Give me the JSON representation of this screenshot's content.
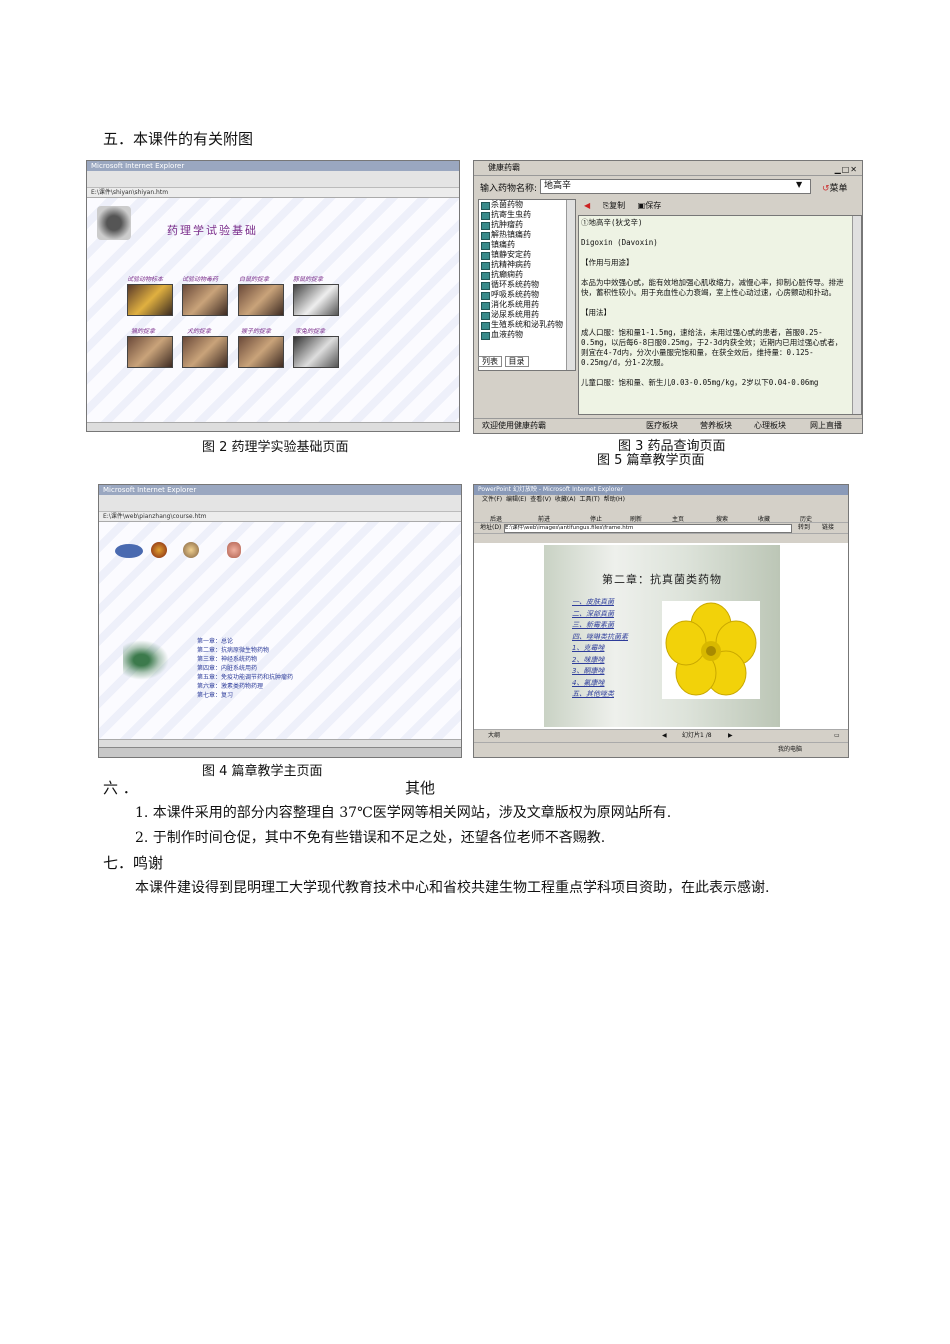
{
  "section5": {
    "heading": "五．本课件的有关附图"
  },
  "fig2": {
    "caption": "图 2 药理学实验基础页面",
    "banner": "药理学试验基础",
    "thumbs_row1": [
      "试验动物标本",
      "试验动物毒药",
      "白鼠的捉拿",
      "豚鼠的捉拿"
    ],
    "thumbs_row2": [
      "猫的捉拿",
      "犬的捉拿",
      "猴子的捉拿",
      "家兔的捉拿"
    ]
  },
  "fig3": {
    "caption": "图 3 药品查询页面",
    "window_title": "健康药霸",
    "search_label": "输入药物名称:",
    "search_value": "地高辛",
    "menu_label": "菜单",
    "copy_label": "复制",
    "save_label": "保存",
    "tree": [
      "杀菌药物",
      "抗寄生虫药",
      "抗肿瘤药",
      "解热镇痛药",
      "镇痛药",
      "镇静安定药",
      "抗精神病药",
      "抗癫痫药",
      "循环系统药物",
      "呼吸系统药物",
      "消化系统用药",
      "泌尿系统用药",
      "生殖系统和泌乳药物",
      "血液药物"
    ],
    "tab_list": "列表",
    "tab_dir": "目录",
    "content": [
      "①地高辛(狄戈辛)",
      "Digoxin (Davoxin)",
      "【作用与用途】",
      "本品为中效强心甙，能有效地加强心肌收缩力，减慢心率，抑制心脏传导。排泄快，蓄积性较小。用于充血性心力衰竭，室上性心动过速，心房颤动和扑动。",
      "【用法】",
      "成人口服：饱和量1-1.5mg，速给法，未用过强心甙的患者，首服0.25-0.5mg，以后每6-8日服0.25mg，于2-3d内获全效；近期内已用过强心甙者，则宜在4-7d内，分次小量服完饱和量，在获全效后，维持量：0.125-0.25mg/d，分1-2次服。",
      "儿童口服：饱和量、新生儿0.03-0.05mg/kg，2岁以下0.04-0.06mg"
    ],
    "status": "欢迎使用健康药霸",
    "status_btns": [
      "医疗板块",
      "营养板块",
      "心理板块",
      "网上直播"
    ]
  },
  "fig5": {
    "caption": "图 5 篇章教学页面"
  },
  "fig4": {
    "caption": "图 4 篇章教学主页面",
    "chapters": [
      "第一章：总论",
      "第二章：抗病原微生物药物",
      "第三章：神经系统药物",
      "第四章：内脏系统用药",
      "第五章：免疫功能调节药和抗肿瘤药",
      "第六章：激素类药物药理",
      "第七章：复习"
    ]
  },
  "fig5_shot": {
    "window_title": "PowerPoint 幻灯放映 - Microsoft Internet Explorer",
    "menu": [
      "文件(F)",
      "编辑(E)",
      "查看(V)",
      "收藏(A)",
      "工具(T)",
      "帮助(H)"
    ],
    "toolbar": [
      "后退",
      "前进",
      "停止",
      "刷新",
      "主页",
      "搜索",
      "收藏",
      "历史"
    ],
    "address": "E:\\课件\\web\\images\\antifungus.files\\frame.htm",
    "go": "转到",
    "links": "链接",
    "slide_title": "第二章：抗真菌类药物",
    "items": [
      "一、皮肤真菌",
      "二、深部真菌",
      "三、新霉素菌",
      "四、唑啉类抗菌素",
      "1、克霉唑",
      "2、咪康唑",
      "3、酮康唑",
      "4、氟康唑",
      "五、其他唑类"
    ],
    "outline": "大纲",
    "slide_no": "幻灯片1 /8",
    "zone": "我的电脑"
  },
  "section6": {
    "heading_num": "六 ．",
    "heading_text": "其他",
    "p1": "1. 本课件采用的部分内容整理自 37℃医学网等相关网站，涉及文章版权为原网站所有.",
    "p2": "2. 于制作时间仓促，其中不免有些错误和不足之处，还望各位老师不吝赐教."
  },
  "section7": {
    "heading": "七．鸣谢",
    "p1": "本课件建设得到昆明理工大学现代教育技术中心和省校共建生物工程重点学科项目资助，在此表示感谢."
  }
}
